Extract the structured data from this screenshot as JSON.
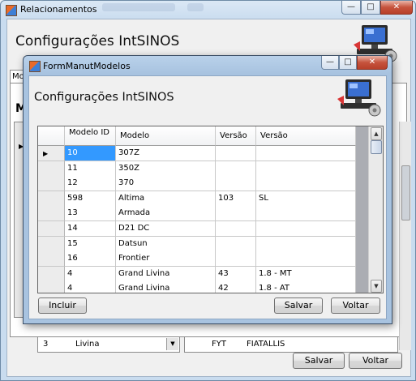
{
  "outer": {
    "title": "Relacionamentos",
    "header_title": "Configurações IntSINOS",
    "tab_label": "Modelos",
    "bg_heading_letter": "M",
    "bg_row_left": {
      "col1": "3",
      "col2": "Livina"
    },
    "bg_row_right": {
      "col1": "FYT",
      "col2": "FIATALLIS"
    },
    "save_label": "Salvar",
    "back_label": "Voltar"
  },
  "dialog": {
    "title": "FormManutModelos",
    "header_title": "Configurações IntSINOS",
    "columns": [
      "Modelo ID",
      "Modelo",
      "Versão ID",
      "Versão"
    ],
    "rows": [
      {
        "modelo_id": "10",
        "modelo": "307Z",
        "versao_id": "",
        "versao": ""
      },
      {
        "modelo_id": "11",
        "modelo": "350Z",
        "versao_id": "",
        "versao": ""
      },
      {
        "modelo_id": "12",
        "modelo": "370",
        "versao_id": "",
        "versao": ""
      },
      {
        "modelo_id": "598",
        "modelo": "Altima",
        "versao_id": "103",
        "versao": "SL"
      },
      {
        "modelo_id": "13",
        "modelo": "Armada",
        "versao_id": "",
        "versao": ""
      },
      {
        "modelo_id": "14",
        "modelo": "D21 DC",
        "versao_id": "",
        "versao": ""
      },
      {
        "modelo_id": "15",
        "modelo": "Datsun",
        "versao_id": "",
        "versao": ""
      },
      {
        "modelo_id": "16",
        "modelo": "Frontier",
        "versao_id": "",
        "versao": ""
      },
      {
        "modelo_id": "4",
        "modelo": "Grand Livina",
        "versao_id": "43",
        "versao": "1.8 - MT"
      },
      {
        "modelo_id": "4",
        "modelo": "Grand Livina",
        "versao_id": "42",
        "versao": "1.8 - AT"
      }
    ],
    "include_label": "Incluir",
    "save_label": "Salvar",
    "back_label": "Voltar"
  },
  "icons": {
    "window_icon": "form-app-icon",
    "header_icon": "computer-settings-icon",
    "current_row": "current-row-arrow-icon"
  }
}
